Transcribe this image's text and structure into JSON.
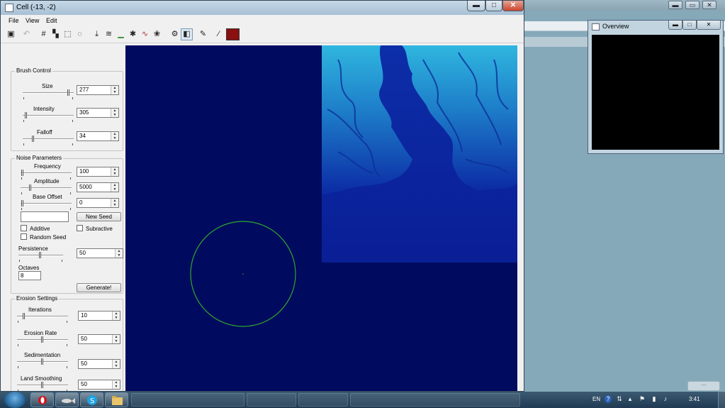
{
  "main_window": {
    "title": "Cell (-13, -2)",
    "controls": {
      "minimize": "▬",
      "maximize": "□",
      "close": "✕"
    }
  },
  "menu": [
    {
      "label": "File"
    },
    {
      "label": "View"
    },
    {
      "label": "Edit"
    }
  ],
  "toolbar": {
    "icons": [
      "save-icon",
      "undo-icon",
      "grid-icon",
      "stamp-icon",
      "rect-select-icon",
      "lasso-icon",
      "lower-icon",
      "smooth-icon",
      "flatten-icon",
      "noise-brush-icon",
      "erode-icon",
      "erosion-brush-icon",
      "stamp-brush-icon",
      "view-toggle-icon",
      "paint-brush-icon",
      "eyedropper-icon"
    ],
    "paint_color": "#8b1010"
  },
  "brush_control": {
    "title": "Brush Control",
    "size": {
      "label": "Size",
      "value": "277",
      "level": 0.94
    },
    "intensity": {
      "label": "Intensity",
      "value": "305",
      "level": 0.05
    },
    "falloff": {
      "label": "Falloff",
      "value": "34",
      "level": 0.2
    }
  },
  "noise": {
    "title": "Noise Parameters",
    "frequency": {
      "label": "Frequency",
      "value": "100",
      "level": 0.02
    },
    "amplitude": {
      "label": "Amplitude",
      "value": "5000",
      "level": 0.18
    },
    "base_offset": {
      "label": "Base Offset",
      "value": "0",
      "level": 0.02
    },
    "seed_value": "",
    "new_seed": "New Seed",
    "additive": "Additive",
    "subtractive": "Subractive",
    "random_seed": "Random Seed",
    "persistence": {
      "label": "Persistence",
      "value": "50",
      "level": 0.5
    },
    "octaves": {
      "label": "Octaves",
      "value": "8"
    },
    "generate": "Generate!"
  },
  "erosion": {
    "title": "Erosion Settings",
    "iterations": {
      "label": "Iterations",
      "value": "10",
      "level": 0.12
    },
    "erosion_rate": {
      "label": "Erosion Rate",
      "value": "50",
      "level": 0.5
    },
    "sedimentation": {
      "label": "Sedimentation",
      "value": "50",
      "level": 0.5
    },
    "land_smoothing": {
      "label": "Land Smoothing",
      "value": "50",
      "level": 0.5
    }
  },
  "overview": {
    "title": "Overview"
  },
  "taskbar": {
    "pinned": [
      "opera-icon",
      "fish-app-icon",
      "skype-icon",
      "folder-icon"
    ],
    "language": "EN",
    "clock": "3:41"
  },
  "colors": {
    "canvas_background": "#000a5e",
    "brush_outline": "#2ea82e",
    "terrain_low": "#0a1ea0",
    "terrain_high": "#39c6e6"
  }
}
